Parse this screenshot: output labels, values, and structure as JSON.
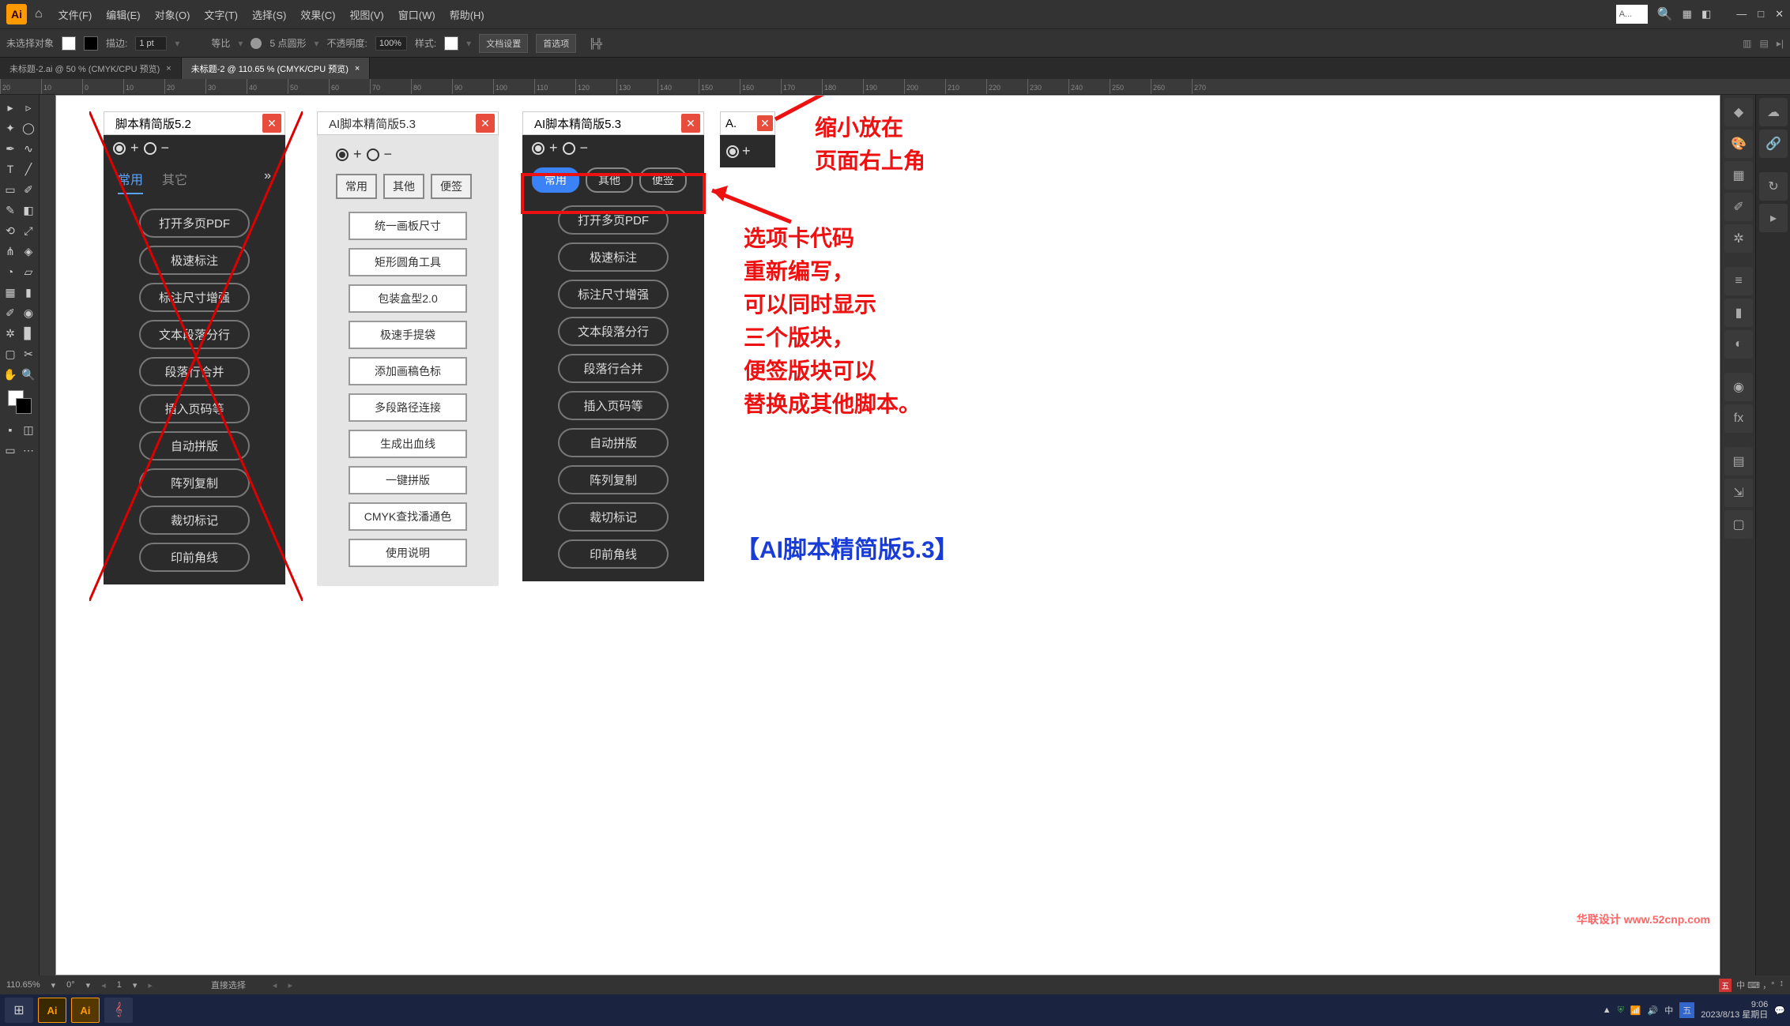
{
  "menubar": {
    "items": [
      "文件(F)",
      "编辑(E)",
      "对象(O)",
      "文字(T)",
      "选择(S)",
      "效果(C)",
      "视图(V)",
      "窗口(W)",
      "帮助(H)"
    ],
    "search_tab": "A..."
  },
  "optionsbar": {
    "no_selection": "未选择对象",
    "stroke_label": "描边:",
    "stroke_val": "1 pt",
    "uniform_label": "等比",
    "brush_label": "5 点圆形",
    "opacity_label": "不透明度:",
    "opacity_val": "100%",
    "style_label": "样式:",
    "doc_setup": "文档设置",
    "prefs": "首选项"
  },
  "tabs": [
    "未标题-2.ai @ 50 % (CMYK/CPU 预览)",
    "未标题-2 @ 110.65 % (CMYK/CPU 预览)"
  ],
  "ruler_ticks": [
    "20",
    "10",
    "0",
    "10",
    "20",
    "30",
    "40",
    "50",
    "60",
    "70",
    "80",
    "90",
    "100",
    "110",
    "120",
    "130",
    "140",
    "150",
    "160",
    "170",
    "180",
    "190",
    "200",
    "210",
    "220",
    "230",
    "240",
    "250",
    "260",
    "270"
  ],
  "panel1": {
    "title": "脚本精简版5.2",
    "tabs": [
      "常用",
      "其它"
    ],
    "buttons": [
      "打开多页PDF",
      "极速标注",
      "标注尺寸增强",
      "文本段落分行",
      "段落行合并",
      "插入页码等",
      "自动拼版",
      "阵列复制",
      "裁切标记",
      "印前角线"
    ]
  },
  "panel2": {
    "title": "AI脚本精简版5.3",
    "tabs": [
      "常用",
      "其他",
      "便签"
    ],
    "buttons": [
      "统一画板尺寸",
      "矩形圆角工具",
      "包装盒型2.0",
      "极速手提袋",
      "添加画稿色标",
      "多段路径连接",
      "生成出血线",
      "一键拼版",
      "CMYK查找潘通色",
      "使用说明"
    ]
  },
  "panel3": {
    "title": "AI脚本精简版5.3",
    "tabs": [
      "常用",
      "其他",
      "便签"
    ],
    "buttons": [
      "打开多页PDF",
      "极速标注",
      "标注尺寸增强",
      "文本段落分行",
      "段落行合并",
      "插入页码等",
      "自动拼版",
      "阵列复制",
      "裁切标记",
      "印前角线"
    ]
  },
  "panel4": {
    "title": "A."
  },
  "ann": {
    "line1": "缩小放在",
    "line2": "页面右上角",
    "block": "选项卡代码\n重新编写，\n可以同时显示\n三个版块，\n便签版块可以\n替换成其他脚本。",
    "footer": "【AI脚本精简版5.3】"
  },
  "status": {
    "zoom": "110.65%",
    "rot": "0°",
    "artboard": "1",
    "tool_hint": "直接选择"
  },
  "taskbar": {
    "time": "9:06",
    "date": "2023/8/13 星期日"
  },
  "watermark": "华联设计 www.52cnp.com"
}
